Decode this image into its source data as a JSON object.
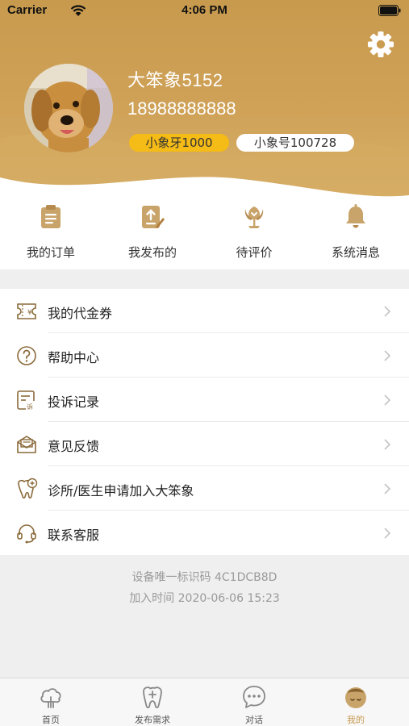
{
  "status_bar": {
    "carrier": "Carrier",
    "time": "4:06 PM"
  },
  "profile": {
    "username": "大笨象5152",
    "phone": "18988888888",
    "ivory_badge": "小象牙1000",
    "id_badge": "小象号100728"
  },
  "quick_actions": [
    {
      "label": "我的订单",
      "icon": "clipboard-icon"
    },
    {
      "label": "我发布的",
      "icon": "publish-edit-icon"
    },
    {
      "label": "待评价",
      "icon": "flower-review-icon"
    },
    {
      "label": "系统消息",
      "icon": "bell-icon"
    }
  ],
  "menu": [
    {
      "label": "我的代金券",
      "icon": "voucher-icon"
    },
    {
      "label": "帮助中心",
      "icon": "help-icon"
    },
    {
      "label": "投诉记录",
      "icon": "complaint-icon"
    },
    {
      "label": "意见反馈",
      "icon": "feedback-icon"
    },
    {
      "label": "诊所/医生申请加入大笨象",
      "icon": "tooth-add-icon"
    },
    {
      "label": "联系客服",
      "icon": "headset-icon"
    }
  ],
  "footer": {
    "device_id": "设备唯一标识码 4C1DCB8D",
    "join_time": "加入时间 2020-06-06 15:23"
  },
  "tabs": [
    {
      "label": "首页",
      "icon": "home-cloud-icon",
      "active": false
    },
    {
      "label": "发布需求",
      "icon": "tooth-plus-icon",
      "active": false
    },
    {
      "label": "对话",
      "icon": "chat-icon",
      "active": false
    },
    {
      "label": "我的",
      "icon": "profile-face-icon",
      "active": true
    }
  ],
  "colors": {
    "accent": "#c89a4e",
    "badge_yellow": "#f5bb16",
    "icon_tan": "#c9a46a"
  }
}
